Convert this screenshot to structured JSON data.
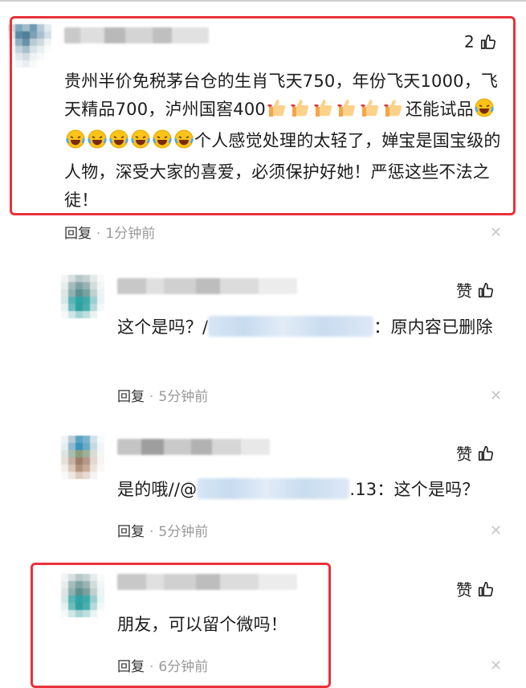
{
  "comments": [
    {
      "like_label": "2",
      "text_parts": {
        "a": "贵州半价免税茅台仓的生肖飞天750，年份飞天1000，飞天精品700，泸州国窖400",
        "b": "还能试品",
        "c": "个人感觉处理的太轻了，婵宝是国宝级的人物，深受大家的喜爱，必须保护好她！严惩这些不法之徒！"
      },
      "reply_label": "回复",
      "time": "1分钟前"
    },
    {
      "like_label": "赞",
      "text_parts": {
        "a": "这个是吗？/",
        "b": "：原内容已删除"
      },
      "reply_label": "回复",
      "time": "5分钟前"
    },
    {
      "like_label": "赞",
      "text_parts": {
        "a": "是的哦//@",
        "b": ".13：这个是吗？"
      },
      "reply_label": "回复",
      "time": "5分钟前"
    },
    {
      "like_label": "赞",
      "text_parts": {
        "a": "朋友，可以留个微吗！"
      },
      "reply_label": "回复",
      "time": "6分钟前"
    }
  ],
  "icons": {
    "like": "thumbs-up-icon",
    "close": "close-icon",
    "emoji_a": "thumbs-up-emoji",
    "emoji_b": "laughing-crying-emoji"
  },
  "colors": {
    "highlight_box": "#e8323a",
    "time_gray": "#9a9a9a"
  }
}
